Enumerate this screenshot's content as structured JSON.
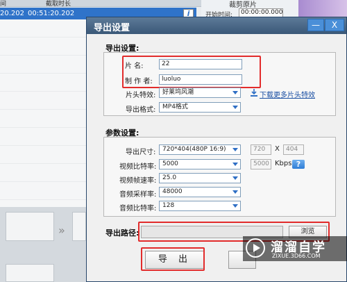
{
  "background": {
    "header_col1": "间",
    "header_col2": "截取时长",
    "selected_row_left": "20.202",
    "selected_row_duration": "00:51:20.202",
    "trim_section_label": "裁剪原片",
    "start_time_label": "开始时间:",
    "start_time_value": "00:00:00.000"
  },
  "dialog": {
    "title": "导出设置",
    "export_settings_title": "导出设置:",
    "name_label": "片  名:",
    "name_value": "22",
    "author_label": "制 作 者:",
    "author_value": "luoluo",
    "effect_label": "片头特效:",
    "effect_value": "好莱坞风潮",
    "more_effects_link": "下载更多片头特效",
    "format_label": "导出格式:",
    "format_value": "MP4格式",
    "param_settings_title": "参数设置:",
    "size_label": "导出尺寸:",
    "size_value": "720*404(480P 16:9)",
    "width_value": "720",
    "times_sign": "X",
    "height_value": "404",
    "video_bitrate_label": "视频比特率:",
    "video_bitrate_value": "5000",
    "video_bitrate_custom": "5000",
    "kbps_label": "Kbps",
    "help_label": "?",
    "framerate_label": "视频帧速率:",
    "framerate_value": "25.0",
    "audio_samplerate_label": "音频采样率:",
    "audio_samplerate_value": "48000",
    "audio_bitrate_label": "音频比特率:",
    "audio_bitrate_value": "128",
    "path_label": "导出路径:",
    "path_value": "",
    "browse_label": "浏览",
    "export_label": "导 出",
    "minimize_glyph": "—",
    "close_glyph": "X"
  },
  "watermark": {
    "main": "溜溜自学",
    "sub": "ZIXUE.3D66.COM"
  },
  "colors": {
    "titlebar": "#3a5878",
    "highlight_red": "#e22b2b",
    "selection_blue": "#2f73c9"
  }
}
